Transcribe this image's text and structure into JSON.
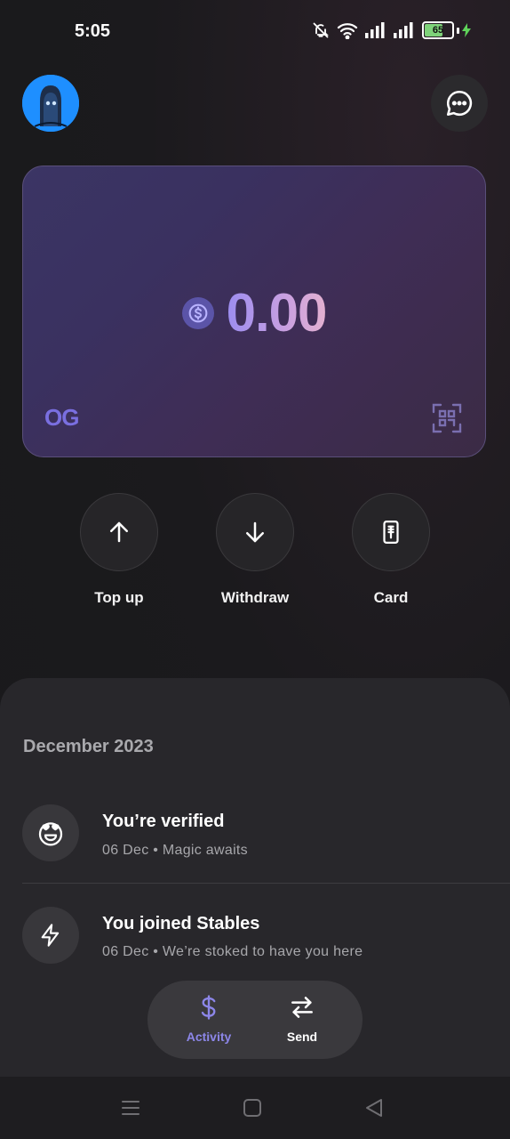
{
  "status_bar": {
    "time": "5:05",
    "battery": "65"
  },
  "balance": {
    "amount": "0.00",
    "brand": "OG"
  },
  "actions": [
    {
      "label": "Top up",
      "icon": "arrow-up-icon"
    },
    {
      "label": "Withdraw",
      "icon": "arrow-down-icon"
    },
    {
      "label": "Card",
      "icon": "card-icon"
    }
  ],
  "activity": {
    "month": "December 2023",
    "items": [
      {
        "title": "You’re verified",
        "subtitle": "06 Dec • Magic awaits",
        "icon": "heart-eyes-icon"
      },
      {
        "title": "You joined Stables",
        "subtitle": "06 Dec • We’re stoked to have you here",
        "icon": "bolt-icon"
      }
    ]
  },
  "bottom_nav": [
    {
      "label": "Activity",
      "icon": "dollar-icon",
      "active": true,
      "color": "#8c86e8"
    },
    {
      "label": "Send",
      "icon": "swap-icon",
      "active": false,
      "color": "#ffffff"
    }
  ],
  "colors": {
    "accent": "#8c86e8",
    "background": "#19191b",
    "sheet": "#28272b"
  }
}
